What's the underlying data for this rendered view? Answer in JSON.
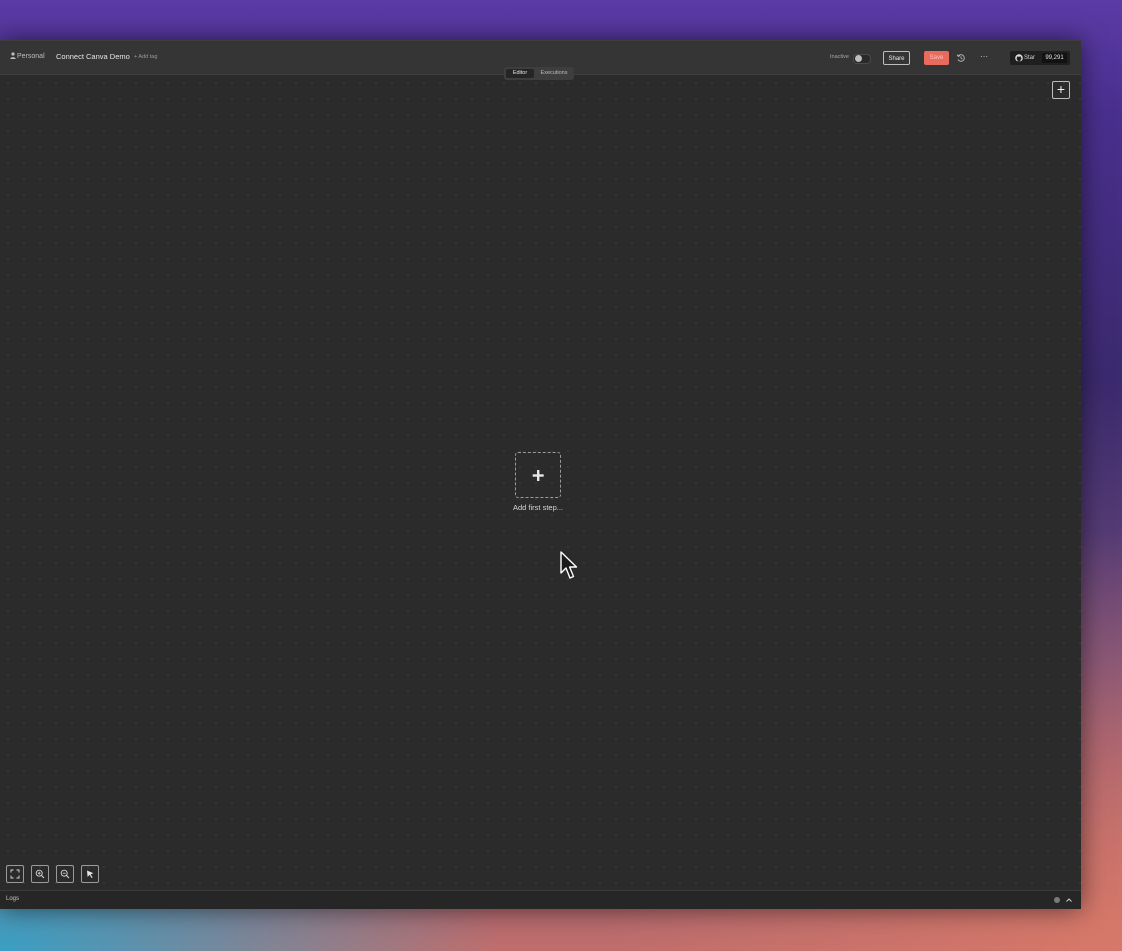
{
  "topbar": {
    "workspace": "Personal",
    "workflow_title": "Connect Canva Demo",
    "add_tag": "+ Add tag",
    "active_toggle_label": "Inactive",
    "share_label": "Share",
    "save_label": "Save",
    "github_star_label": "Star",
    "github_star_count": "99,291"
  },
  "tabs": [
    {
      "label": "Editor",
      "selected": true
    },
    {
      "label": "Executions",
      "selected": false
    }
  ],
  "canvas": {
    "first_step_label": "Add first step..."
  },
  "logs": {
    "label": "Logs"
  },
  "icons": {
    "workspace": "person-icon",
    "history": "history-icon",
    "more": "more-icon",
    "github": "github-icon",
    "add_node": "plus-icon",
    "fit": "fit-view-icon",
    "zoom_in": "zoom-in-icon",
    "zoom_out": "zoom-out-icon",
    "select": "cursor-icon",
    "logs_expand": "chevron-up-icon"
  },
  "colors": {
    "save_button": "#ea6a5e",
    "canvas_background": "#2b2b2b"
  }
}
